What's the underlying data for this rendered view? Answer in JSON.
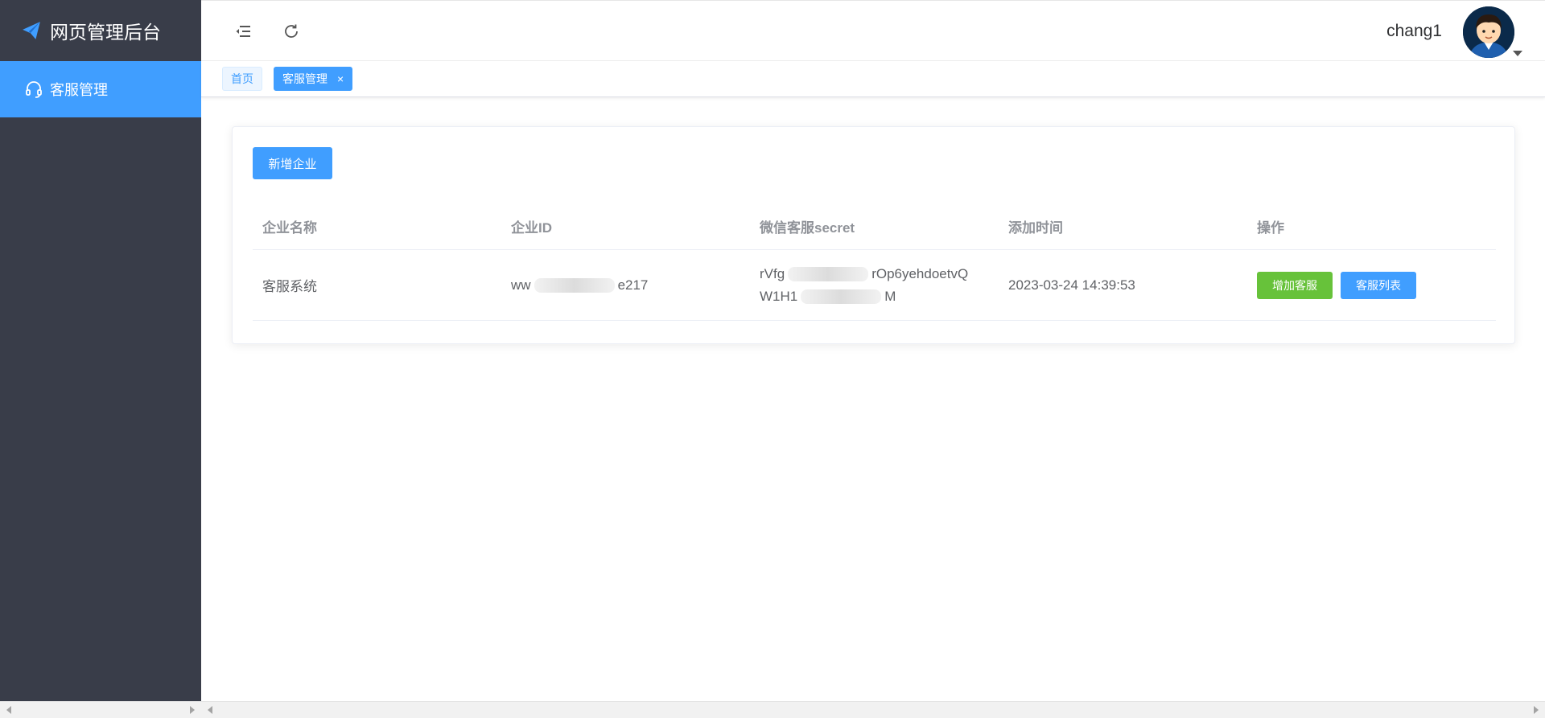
{
  "app": {
    "title": "网页管理后台"
  },
  "sidebar": {
    "items": [
      {
        "label": "客服管理",
        "icon": "headset-icon"
      }
    ]
  },
  "header": {
    "username": "chang1",
    "icons": [
      "collapse-menu-icon",
      "refresh-icon"
    ]
  },
  "tags": [
    {
      "label": "首页"
    },
    {
      "label": "客服管理",
      "close": "×"
    }
  ],
  "toolbar": {
    "add_label": "新增企业"
  },
  "table": {
    "columns": [
      "企业名称",
      "企业ID",
      "微信客服secret",
      "添加时间",
      "操作"
    ],
    "rows": [
      {
        "name": "客服系统",
        "id_prefix": "ww",
        "id_suffix": "e217",
        "secret_line1_prefix": "rVfg",
        "secret_line1_suffix": "rOp6yehdoetvQ",
        "secret_line2_prefix": "W1H1",
        "secret_line2_suffix": "M",
        "time": "2023-03-24 14:39:53",
        "actions": [
          "增加客服",
          "客服列表"
        ]
      }
    ]
  },
  "colors": {
    "primary": "#409eff",
    "success": "#67c23a",
    "sidebar": "#393d49"
  }
}
